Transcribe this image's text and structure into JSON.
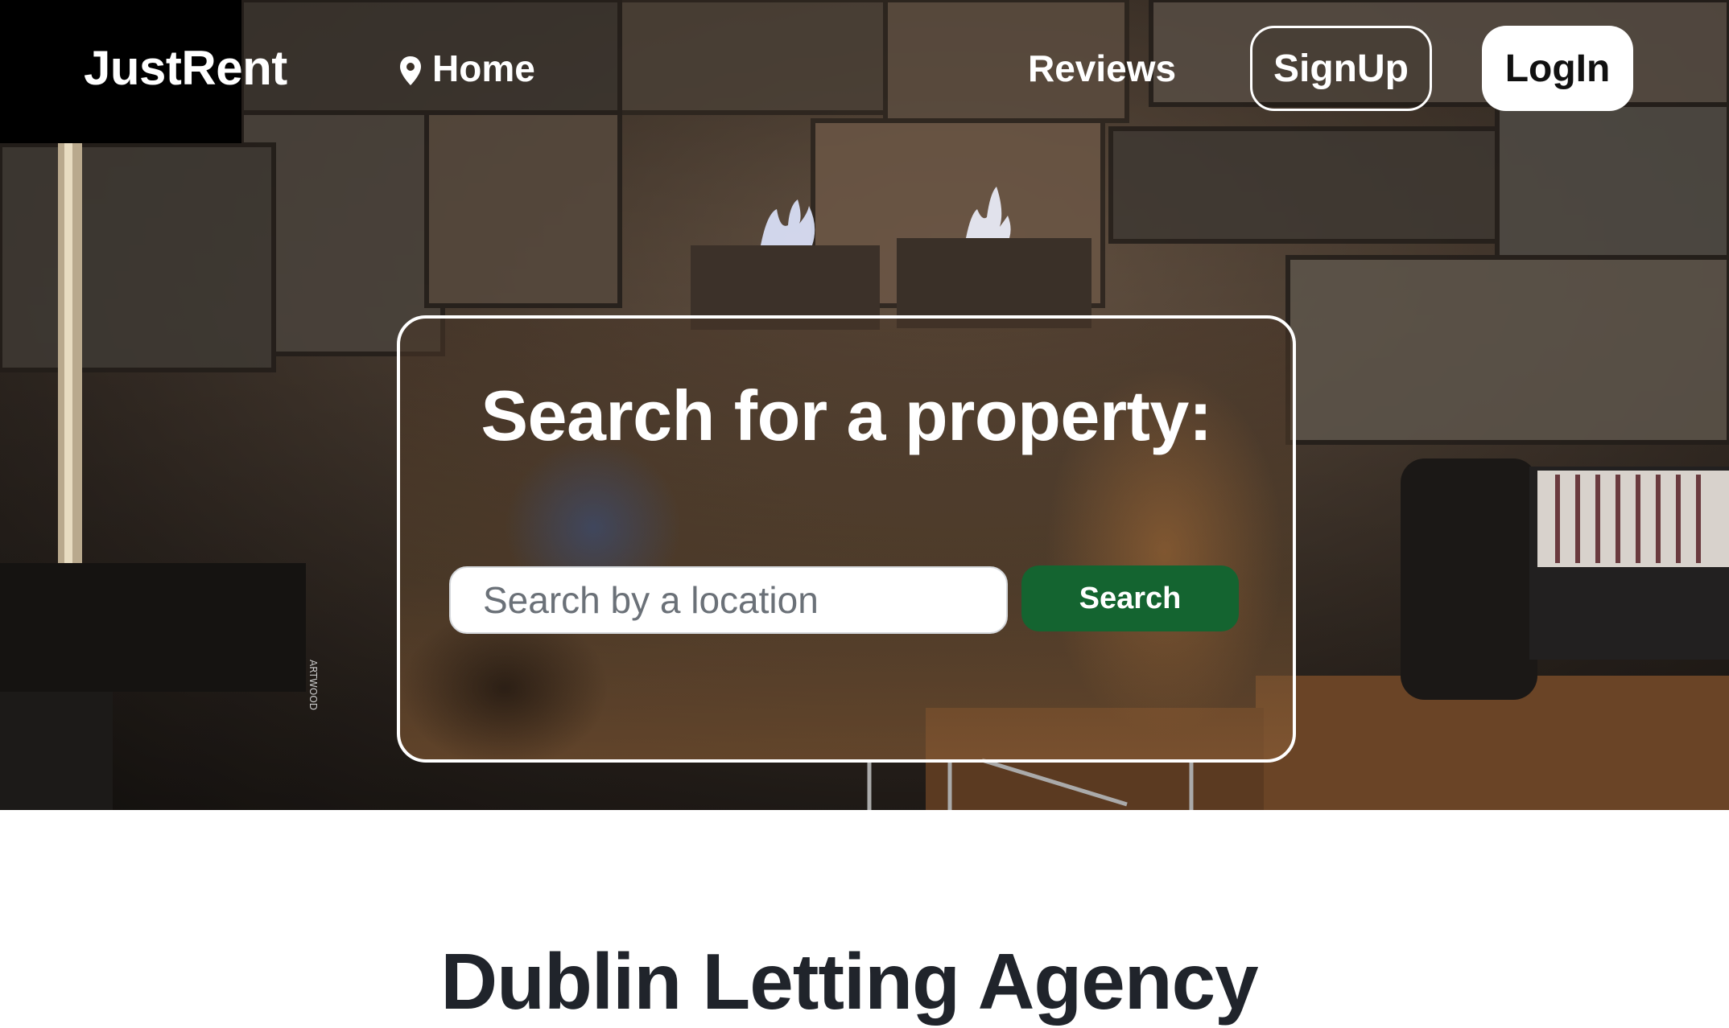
{
  "nav": {
    "brand": "JustRent",
    "home_label": "Home",
    "home_icon": "map-pin-icon",
    "reviews_label": "Reviews",
    "signup_label": "SignUp",
    "login_label": "LogIn"
  },
  "search": {
    "title": "Search for a property:",
    "placeholder": "Search by a location",
    "value": "",
    "button_label": "Search"
  },
  "hero_decor": {
    "stand_label": "ARTWOOD"
  },
  "main": {
    "title": "Dublin Letting Agency"
  },
  "colors": {
    "search_button": "#146430",
    "heading_text": "#20242b",
    "brand_box": "#000000"
  }
}
